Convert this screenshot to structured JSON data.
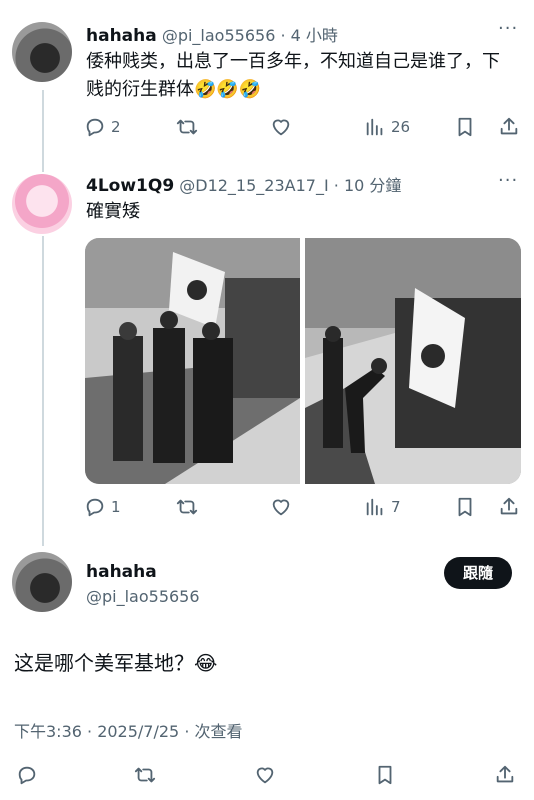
{
  "reply1": {
    "name": "hahaha",
    "handle": "@pi_lao55656",
    "time": "4 小時",
    "text": "倭种贱类，出息了一百多年，不知道自己是谁了，下贱的衍生群体",
    "emoji": "🤣🤣🤣",
    "replies": "2",
    "views": "26"
  },
  "reply2": {
    "name": "4Low1Q9",
    "handle": "@D12_15_23A17_I",
    "time": "10 分鐘",
    "text": "確實矮",
    "replies": "1",
    "views": "7"
  },
  "main": {
    "name": "hahaha",
    "handle": "@pi_lao55656",
    "follow_label": "跟隨",
    "text": "这是哪个美军基地？",
    "emoji": "😂",
    "meta": "下午3:36 · 2025/7/25 · 次查看"
  },
  "icons": [
    "reply-icon",
    "retweet-icon",
    "like-icon",
    "views-icon",
    "bookmark-icon",
    "share-icon",
    "more-icon"
  ]
}
